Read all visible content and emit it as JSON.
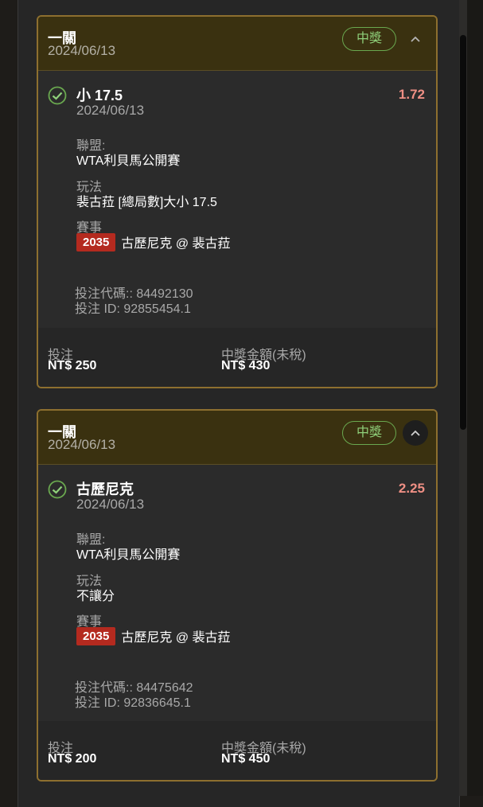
{
  "colors": {
    "card_border": "#8d6f2f",
    "card_header": "#3a3110",
    "win": "#8fd07a",
    "odds": "#ee8f84",
    "event_tag": "#b42a1f"
  },
  "bets": [
    {
      "header": {
        "title": "一關",
        "date": "2024/06/13",
        "badge": "中獎",
        "chevron": "chevron-up-icon"
      },
      "selection": {
        "name": "小 17.5",
        "date": "2024/06/13",
        "odds": "1.72",
        "status_icon": "check-circle-icon"
      },
      "league_label": "聯盟:",
      "league": "WTA利貝馬公開賽",
      "market_label": "玩法",
      "market": "裴古菈 [總局數]大小 17.5",
      "event_label": "賽事",
      "event_code": "2035",
      "event_name": "古歷尼克 @ 裴古菈",
      "bet_code": "投注代碼:: 84492130",
      "bet_id": "投注 ID: 92855454.1",
      "stake_label": "投注",
      "stake": "NT$ 250",
      "payout_label": "中獎金額(未稅)",
      "payout": "NT$ 430"
    },
    {
      "header": {
        "title": "一關",
        "date": "2024/06/13",
        "badge": "中獎",
        "chevron": "chevron-up-icon"
      },
      "selection": {
        "name": "古歷尼克",
        "date": "2024/06/13",
        "odds": "2.25",
        "status_icon": "check-circle-icon"
      },
      "league_label": "聯盟:",
      "league": "WTA利貝馬公開賽",
      "market_label": "玩法",
      "market": "不讓分",
      "event_label": "賽事",
      "event_code": "2035",
      "event_name": "古歷尼克 @ 裴古菈",
      "bet_code": "投注代碼:: 84475642",
      "bet_id": "投注 ID: 92836645.1",
      "stake_label": "投注",
      "stake": "NT$ 200",
      "payout_label": "中獎金額(未稅)",
      "payout": "NT$ 450"
    }
  ]
}
